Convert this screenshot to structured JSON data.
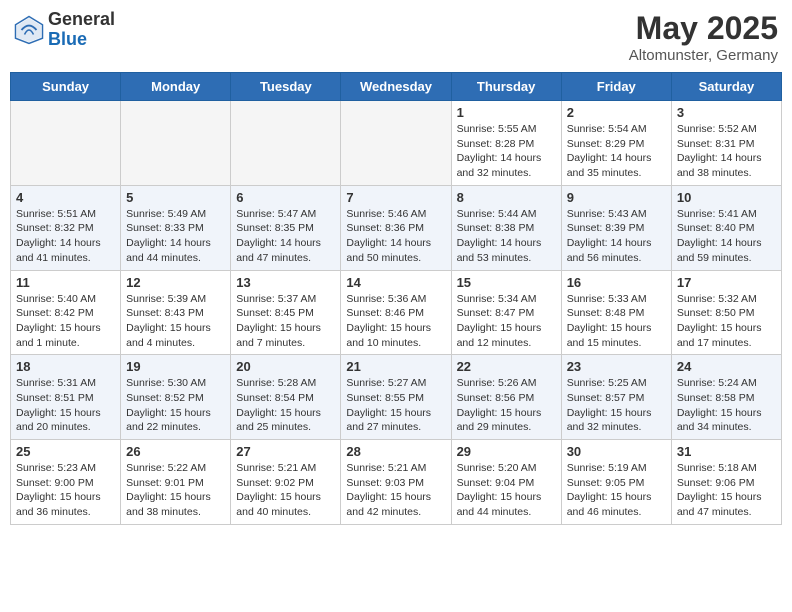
{
  "header": {
    "logo_general": "General",
    "logo_blue": "Blue",
    "month_year": "May 2025",
    "location": "Altomunster, Germany"
  },
  "weekdays": [
    "Sunday",
    "Monday",
    "Tuesday",
    "Wednesday",
    "Thursday",
    "Friday",
    "Saturday"
  ],
  "weeks": [
    [
      {
        "day": "",
        "info": ""
      },
      {
        "day": "",
        "info": ""
      },
      {
        "day": "",
        "info": ""
      },
      {
        "day": "",
        "info": ""
      },
      {
        "day": "1",
        "info": "Sunrise: 5:55 AM\nSunset: 8:28 PM\nDaylight: 14 hours\nand 32 minutes."
      },
      {
        "day": "2",
        "info": "Sunrise: 5:54 AM\nSunset: 8:29 PM\nDaylight: 14 hours\nand 35 minutes."
      },
      {
        "day": "3",
        "info": "Sunrise: 5:52 AM\nSunset: 8:31 PM\nDaylight: 14 hours\nand 38 minutes."
      }
    ],
    [
      {
        "day": "4",
        "info": "Sunrise: 5:51 AM\nSunset: 8:32 PM\nDaylight: 14 hours\nand 41 minutes."
      },
      {
        "day": "5",
        "info": "Sunrise: 5:49 AM\nSunset: 8:33 PM\nDaylight: 14 hours\nand 44 minutes."
      },
      {
        "day": "6",
        "info": "Sunrise: 5:47 AM\nSunset: 8:35 PM\nDaylight: 14 hours\nand 47 minutes."
      },
      {
        "day": "7",
        "info": "Sunrise: 5:46 AM\nSunset: 8:36 PM\nDaylight: 14 hours\nand 50 minutes."
      },
      {
        "day": "8",
        "info": "Sunrise: 5:44 AM\nSunset: 8:38 PM\nDaylight: 14 hours\nand 53 minutes."
      },
      {
        "day": "9",
        "info": "Sunrise: 5:43 AM\nSunset: 8:39 PM\nDaylight: 14 hours\nand 56 minutes."
      },
      {
        "day": "10",
        "info": "Sunrise: 5:41 AM\nSunset: 8:40 PM\nDaylight: 14 hours\nand 59 minutes."
      }
    ],
    [
      {
        "day": "11",
        "info": "Sunrise: 5:40 AM\nSunset: 8:42 PM\nDaylight: 15 hours\nand 1 minute."
      },
      {
        "day": "12",
        "info": "Sunrise: 5:39 AM\nSunset: 8:43 PM\nDaylight: 15 hours\nand 4 minutes."
      },
      {
        "day": "13",
        "info": "Sunrise: 5:37 AM\nSunset: 8:45 PM\nDaylight: 15 hours\nand 7 minutes."
      },
      {
        "day": "14",
        "info": "Sunrise: 5:36 AM\nSunset: 8:46 PM\nDaylight: 15 hours\nand 10 minutes."
      },
      {
        "day": "15",
        "info": "Sunrise: 5:34 AM\nSunset: 8:47 PM\nDaylight: 15 hours\nand 12 minutes."
      },
      {
        "day": "16",
        "info": "Sunrise: 5:33 AM\nSunset: 8:48 PM\nDaylight: 15 hours\nand 15 minutes."
      },
      {
        "day": "17",
        "info": "Sunrise: 5:32 AM\nSunset: 8:50 PM\nDaylight: 15 hours\nand 17 minutes."
      }
    ],
    [
      {
        "day": "18",
        "info": "Sunrise: 5:31 AM\nSunset: 8:51 PM\nDaylight: 15 hours\nand 20 minutes."
      },
      {
        "day": "19",
        "info": "Sunrise: 5:30 AM\nSunset: 8:52 PM\nDaylight: 15 hours\nand 22 minutes."
      },
      {
        "day": "20",
        "info": "Sunrise: 5:28 AM\nSunset: 8:54 PM\nDaylight: 15 hours\nand 25 minutes."
      },
      {
        "day": "21",
        "info": "Sunrise: 5:27 AM\nSunset: 8:55 PM\nDaylight: 15 hours\nand 27 minutes."
      },
      {
        "day": "22",
        "info": "Sunrise: 5:26 AM\nSunset: 8:56 PM\nDaylight: 15 hours\nand 29 minutes."
      },
      {
        "day": "23",
        "info": "Sunrise: 5:25 AM\nSunset: 8:57 PM\nDaylight: 15 hours\nand 32 minutes."
      },
      {
        "day": "24",
        "info": "Sunrise: 5:24 AM\nSunset: 8:58 PM\nDaylight: 15 hours\nand 34 minutes."
      }
    ],
    [
      {
        "day": "25",
        "info": "Sunrise: 5:23 AM\nSunset: 9:00 PM\nDaylight: 15 hours\nand 36 minutes."
      },
      {
        "day": "26",
        "info": "Sunrise: 5:22 AM\nSunset: 9:01 PM\nDaylight: 15 hours\nand 38 minutes."
      },
      {
        "day": "27",
        "info": "Sunrise: 5:21 AM\nSunset: 9:02 PM\nDaylight: 15 hours\nand 40 minutes."
      },
      {
        "day": "28",
        "info": "Sunrise: 5:21 AM\nSunset: 9:03 PM\nDaylight: 15 hours\nand 42 minutes."
      },
      {
        "day": "29",
        "info": "Sunrise: 5:20 AM\nSunset: 9:04 PM\nDaylight: 15 hours\nand 44 minutes."
      },
      {
        "day": "30",
        "info": "Sunrise: 5:19 AM\nSunset: 9:05 PM\nDaylight: 15 hours\nand 46 minutes."
      },
      {
        "day": "31",
        "info": "Sunrise: 5:18 AM\nSunset: 9:06 PM\nDaylight: 15 hours\nand 47 minutes."
      }
    ]
  ]
}
